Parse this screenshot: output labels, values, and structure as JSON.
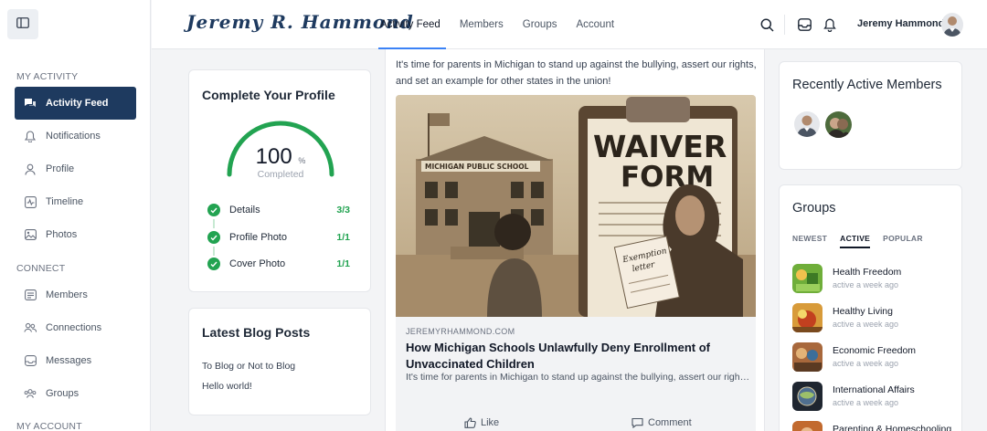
{
  "sidebar": {
    "sections": [
      "MY ACTIVITY",
      "CONNECT",
      "MY ACCOUNT"
    ],
    "items": [
      {
        "label": "Activity Feed",
        "icon": "chat-bubbles-icon",
        "active": true
      },
      {
        "label": "Notifications",
        "icon": "bell-icon"
      },
      {
        "label": "Profile",
        "icon": "user-icon"
      },
      {
        "label": "Timeline",
        "icon": "pulse-icon"
      },
      {
        "label": "Photos",
        "icon": "image-icon"
      },
      {
        "label": "Members",
        "icon": "id-card-icon"
      },
      {
        "label": "Connections",
        "icon": "users-icon"
      },
      {
        "label": "Messages",
        "icon": "inbox-icon"
      },
      {
        "label": "Groups",
        "icon": "group-icon"
      }
    ]
  },
  "header": {
    "logo": "Jeremy R. Hammond",
    "nav": [
      "Activity Feed",
      "Members",
      "Groups",
      "Account"
    ],
    "user_name": "Jeremy Hammond"
  },
  "profile": {
    "title": "Complete Your Profile",
    "percent": "100",
    "percent_sign": "%",
    "status": "Completed",
    "steps": [
      {
        "label": "Details",
        "count": "3/3"
      },
      {
        "label": "Profile Photo",
        "count": "1/1"
      },
      {
        "label": "Cover Photo",
        "count": "1/1"
      }
    ]
  },
  "blog": {
    "title": "Latest Blog Posts",
    "posts": [
      "To Blog or Not to Blog",
      "Hello world!"
    ]
  },
  "feed": {
    "text": "It's time for parents in Michigan to stand up against the bullying, assert our rights, and set an example for other states in the union!",
    "image": {
      "school_sign": "MICHIGAN PUBLIC SCHOOL",
      "form_title_1": "WAIVER",
      "form_title_2": "FORM",
      "letter_1": "Exemption",
      "letter_2": "letter"
    },
    "link_domain": "JEREMYRHAMMOND.COM",
    "link_title": "How Michigan Schools Unlawfully Deny Enrollment of Unvaccinated Children",
    "link_desc": "It's time for parents in Michigan to stand up against the bullying, assert our rights, and set an example for other states in the union!",
    "like_label": "Like",
    "comment_label": "Comment"
  },
  "members": {
    "title": "Recently Active Members"
  },
  "groups": {
    "title": "Groups",
    "tabs": [
      "NEWEST",
      "ACTIVE",
      "POPULAR"
    ],
    "active_tab": "ACTIVE",
    "items": [
      {
        "name": "Health Freedom",
        "time": "active a week ago"
      },
      {
        "name": "Healthy Living",
        "time": "active a week ago"
      },
      {
        "name": "Economic Freedom",
        "time": "active a week ago"
      },
      {
        "name": "International Affairs",
        "time": "active a week ago"
      },
      {
        "name": "Parenting & Homeschooling",
        "time": ""
      }
    ]
  },
  "colors": {
    "accent": "#1e3a5f",
    "success": "#22a351",
    "nav_underline": "#3b82f6"
  }
}
